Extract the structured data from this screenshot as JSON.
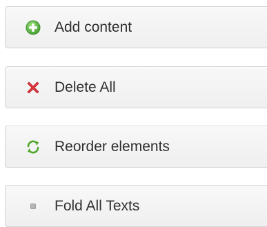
{
  "actions": [
    {
      "id": "add",
      "label": "Add content",
      "icon": "add-circle-icon",
      "icon_color": "#5cb85c"
    },
    {
      "id": "delete",
      "label": "Delete All",
      "icon": "red-x-icon",
      "icon_color": "#e0383f"
    },
    {
      "id": "reorder",
      "label": "Reorder elements",
      "icon": "refresh-arrows-icon",
      "icon_color": "#4fa62a"
    },
    {
      "id": "fold",
      "label": "Fold All Texts",
      "icon": "small-square-icon",
      "icon_color": "#a8a8a8"
    }
  ],
  "colors": {
    "button_background": "#f3f3f3",
    "button_border": "#d4d4d4",
    "text": "#2f2f2f"
  }
}
